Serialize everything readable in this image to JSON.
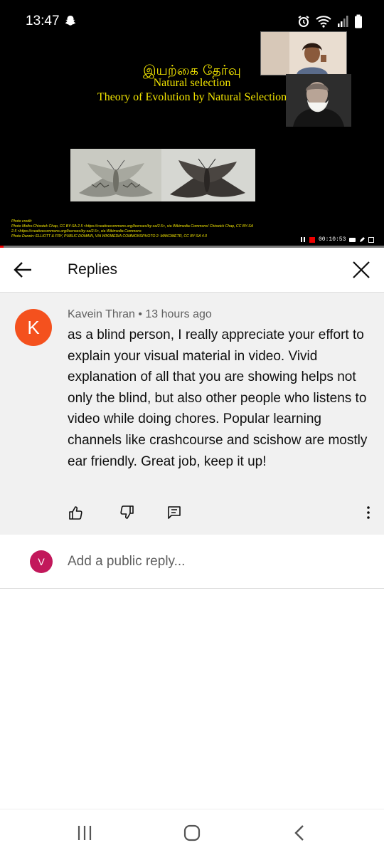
{
  "status_bar": {
    "time": "13:47",
    "icons": [
      "snapchat-icon",
      "alarm-icon",
      "wifi-icon",
      "signal-icon",
      "battery-icon"
    ]
  },
  "video": {
    "slide_title_tamil": "இயற்கை தேர்வு",
    "slide_title_1": "Natural selection",
    "slide_title_2": "Theory of Evolution by Natural Selection",
    "credit_lines": [
      "Photo credit:",
      "Photo Moths:Chiswick Chap, CC BY-SA 2.5 <https://creativecommons.org/licenses/by-sa/2.5>, via Wikimedia Commons/ Chiswick Chap, CC BY-SA",
      "2.5 <https://creativecommons.org/licenses/by-sa/2.5>, via Wikimedia Commons",
      "Photo Darwin: ELLIOTT & FRY, PUBLIC DOMAIN, VIA WIKIMEDIA COMMONSPHOTO 2: MAKOMETR, CC BY-SA 4.0"
    ],
    "timer": "00:10:53",
    "progress": 0.01
  },
  "header": {
    "title": "Replies"
  },
  "comment": {
    "avatar_letter": "K",
    "author": "Kavein Thran",
    "separator": "•",
    "time": "13 hours ago",
    "text": "as a blind person, I really appreciate your effort to explain your visual material in video. Vivid explanation of all that you are showing helps not only the blind, but also other people who listens to video while doing chores. Popular learning channels like crashcourse and scishow are mostly ear friendly. Great job, keep it up!"
  },
  "reply_box": {
    "avatar_letter": "V",
    "placeholder": "Add a public reply..."
  },
  "colors": {
    "accent_avatar": "#f4511e",
    "reply_avatar": "#c2185b",
    "slide_text": "#f2e500",
    "progress": "#e00000"
  }
}
